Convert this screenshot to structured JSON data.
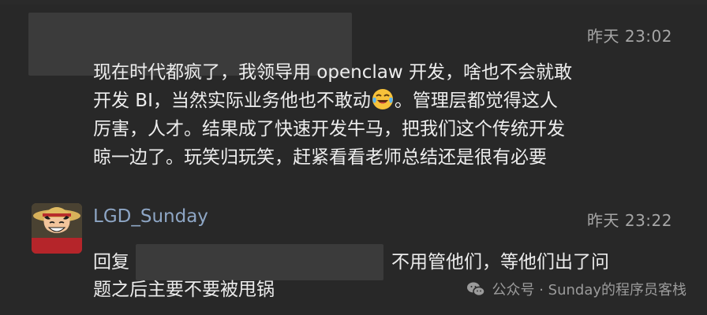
{
  "messages": [
    {
      "timestamp": "昨天 23:02",
      "lines": [
        "现在时代都疯了，我领导用 openclaw 开发，啥也不会就敢",
        "开发 BI，当然实际业务他也不敢动",
        "。管理层都觉得这人",
        "厉害，人才。结果成了快速开发牛马，把我们这个传统开发",
        "晾一边了。玩笑归玩笑，赶紧看看老师总结还是很有必要"
      ],
      "emoji_icon": "face-with-tears-of-joy-icon"
    },
    {
      "username": "LGD_Sunday",
      "timestamp": "昨天 23:22",
      "reply_prefix": "回复",
      "reply_line1": "不用管他们，等他们出了问",
      "reply_line2": "题之后主要不要被甩锅"
    }
  ],
  "watermark": {
    "text": "公众号 · Sunday的程序员客栈",
    "icon": "wechat-icon"
  },
  "colors": {
    "background": "#282828",
    "username": "#8ea6c5",
    "timestamp": "#a6a6a6",
    "text": "#ededed"
  }
}
